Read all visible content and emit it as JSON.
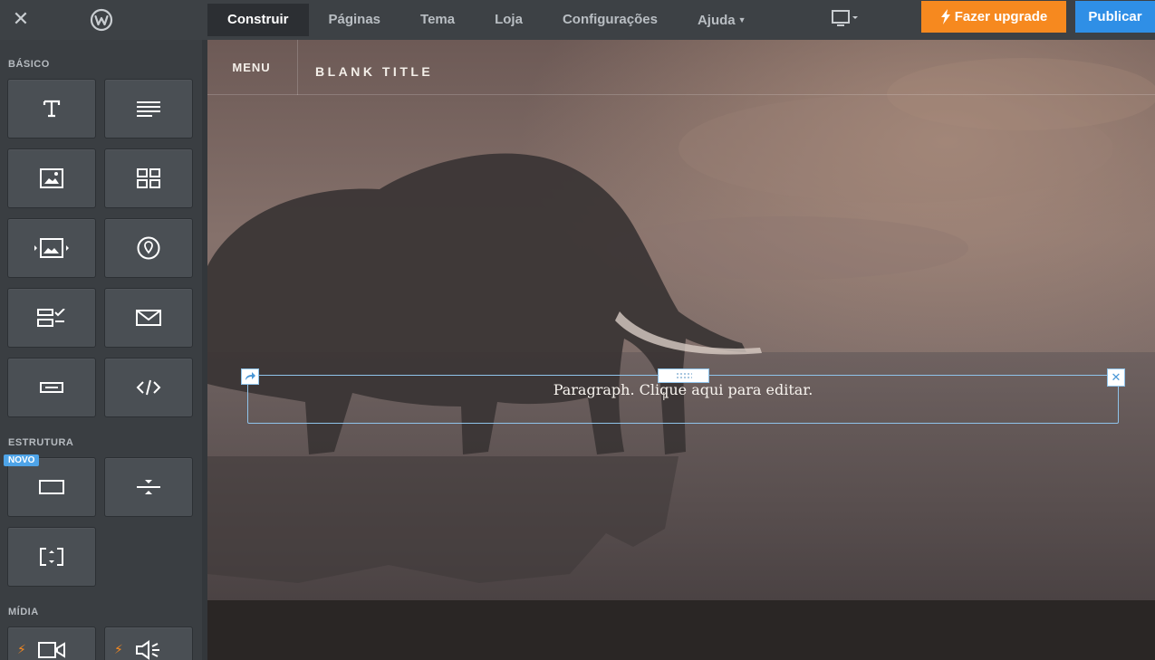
{
  "topbar": {
    "tabs": [
      {
        "label": "Construir",
        "active": true
      },
      {
        "label": "Páginas",
        "active": false
      },
      {
        "label": "Tema",
        "active": false
      },
      {
        "label": "Loja",
        "active": false
      },
      {
        "label": "Configurações",
        "active": false
      },
      {
        "label": "Ajuda",
        "active": false
      }
    ],
    "upgrade_label": "Fazer upgrade",
    "publish_label": "Publicar",
    "colors": {
      "upgrade": "#f6891f",
      "publish": "#2f8fe6",
      "bar": "#3d4145"
    }
  },
  "sidebar": {
    "sections": {
      "basic": "BÁSICO",
      "structure": "ESTRUTURA",
      "media": "MÍDIA"
    },
    "new_badge": "NOVO",
    "tiles": [
      "title-icon",
      "paragraph-icon",
      "image-icon",
      "gallery-icon",
      "slideshow-icon",
      "map-icon",
      "form-icon",
      "contact-form-icon",
      "button-icon",
      "embed-code-icon",
      "section-icon",
      "divider-icon",
      "spacer-icon",
      "video-icon",
      "audio-icon"
    ]
  },
  "site": {
    "menu_label": "MENU",
    "title": "BLANK TITLE",
    "paragraph": "Paragraph. Clique aqui para editar."
  }
}
